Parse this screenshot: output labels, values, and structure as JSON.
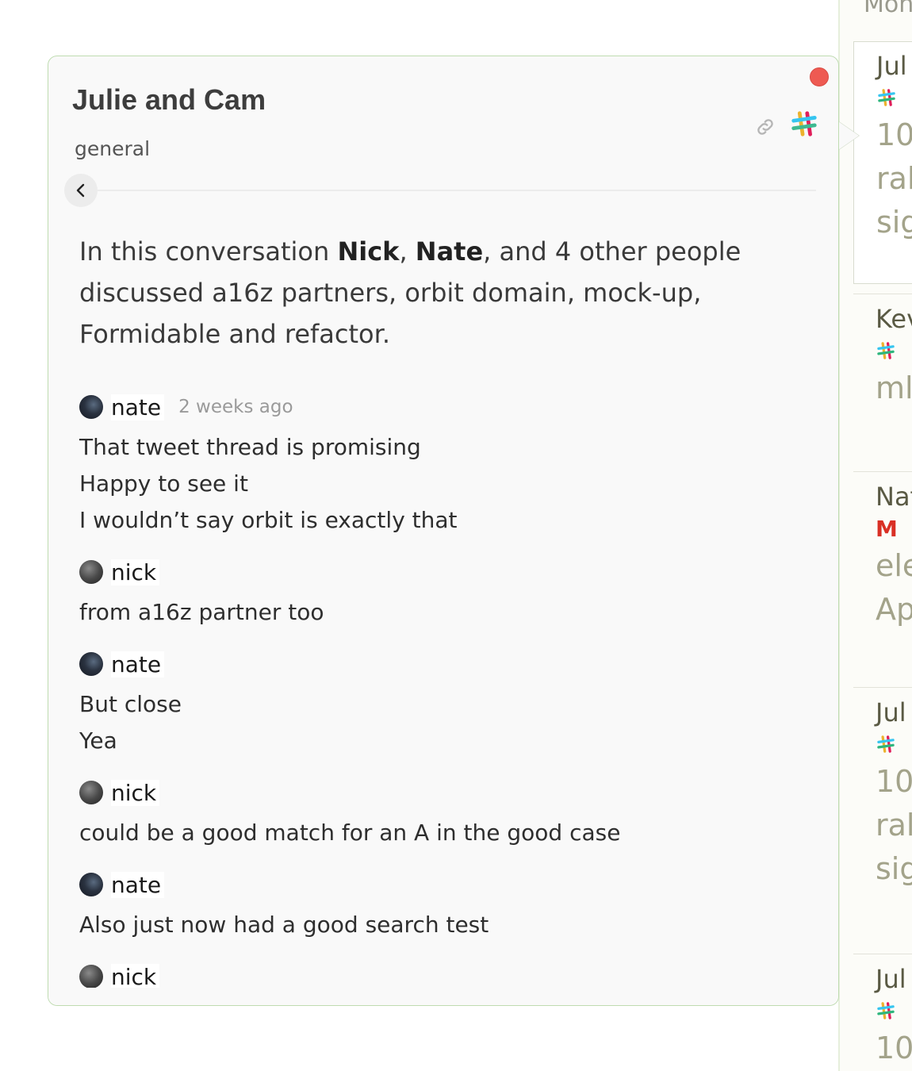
{
  "background_list": {
    "header": "Mon",
    "cards": [
      {
        "title": "Jul",
        "source": "slack",
        "lines": [
          "10",
          "ral",
          "sig"
        ],
        "selected": true
      },
      {
        "title": "Kev",
        "source": "slack",
        "lines": [
          "ml,"
        ]
      },
      {
        "title": "Nat",
        "source": "gmail",
        "lines": [
          "ele",
          "Ap"
        ]
      },
      {
        "title": "Jul",
        "source": "slack",
        "lines": [
          "10",
          "ral",
          "sig"
        ]
      },
      {
        "title": "Jul",
        "source": "slack",
        "lines": [
          "10"
        ]
      }
    ]
  },
  "popup": {
    "title": "Julie and Cam",
    "channel": "general",
    "summary": {
      "prefix": "In this conversation ",
      "person1": "Nick",
      "sep1": ", ",
      "person2": "Nate",
      "rest": ", and 4 other people discussed a16z partners, orbit domain, mock-up, Formidable and refactor."
    },
    "messages": [
      {
        "author": "nate",
        "avatar": "nate",
        "time": "2 weeks ago",
        "lines": [
          "That tweet thread is promising",
          "Happy to see it",
          "I wouldn’t say orbit is exactly that"
        ]
      },
      {
        "author": "nick",
        "avatar": "nick",
        "time": "",
        "lines": [
          "from a16z partner too"
        ]
      },
      {
        "author": "nate",
        "avatar": "nate",
        "time": "",
        "lines": [
          "But close",
          "Yea"
        ]
      },
      {
        "author": "nick",
        "avatar": "nick",
        "time": "",
        "lines": [
          "could be a good match for an A in the good case"
        ]
      },
      {
        "author": "nate",
        "avatar": "nate",
        "time": "",
        "lines": [
          "Also just now had a good search test"
        ]
      },
      {
        "author": "nick",
        "avatar": "nick",
        "time": "",
        "lines": []
      }
    ]
  },
  "colors": {
    "close": "#ee5a52",
    "border": "#bfdcb1",
    "slack": [
      "#36c5f0",
      "#2eb67d",
      "#ecb22e",
      "#e01e5a"
    ]
  }
}
